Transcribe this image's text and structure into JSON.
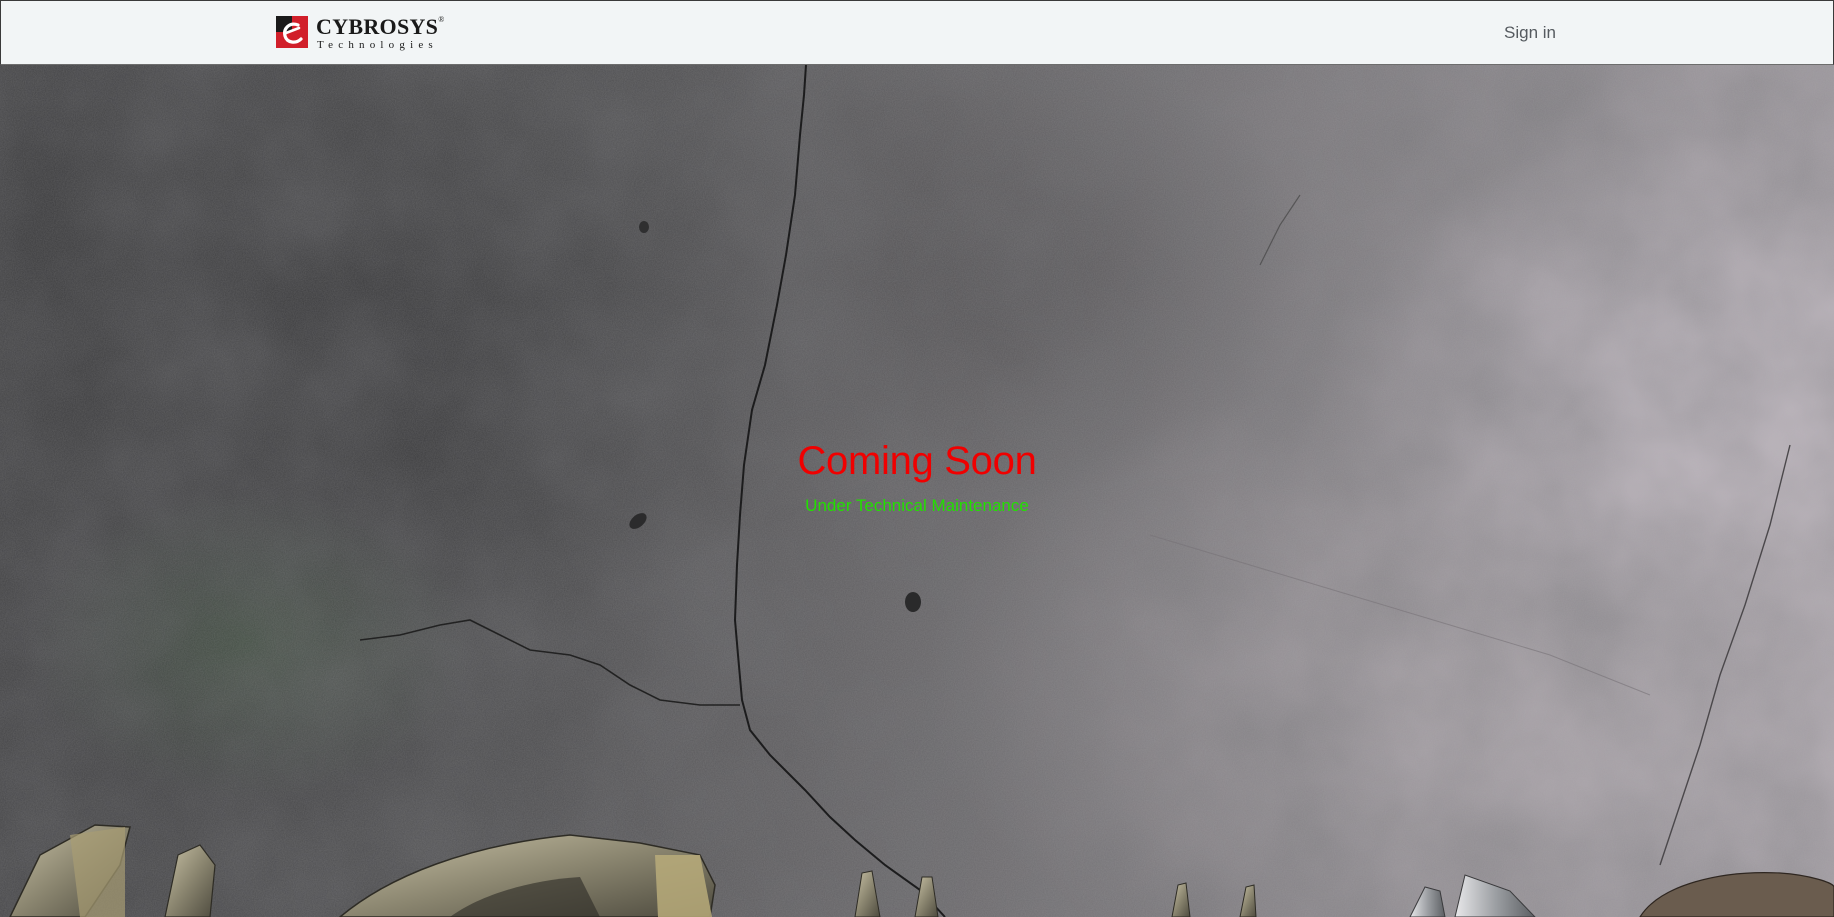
{
  "header": {
    "brand": {
      "name": "CYBROSYS",
      "registered_mark": "®",
      "tagline": "Technologies"
    },
    "signin_label": "Sign in"
  },
  "hero": {
    "title": "Coming Soon",
    "subtitle": "Under Technical Maintenance",
    "colors": {
      "title": "#f00000",
      "subtitle": "#22e000"
    }
  },
  "colors": {
    "navbar_bg": "#f2f5f6",
    "brand_red": "#d11f2a"
  }
}
